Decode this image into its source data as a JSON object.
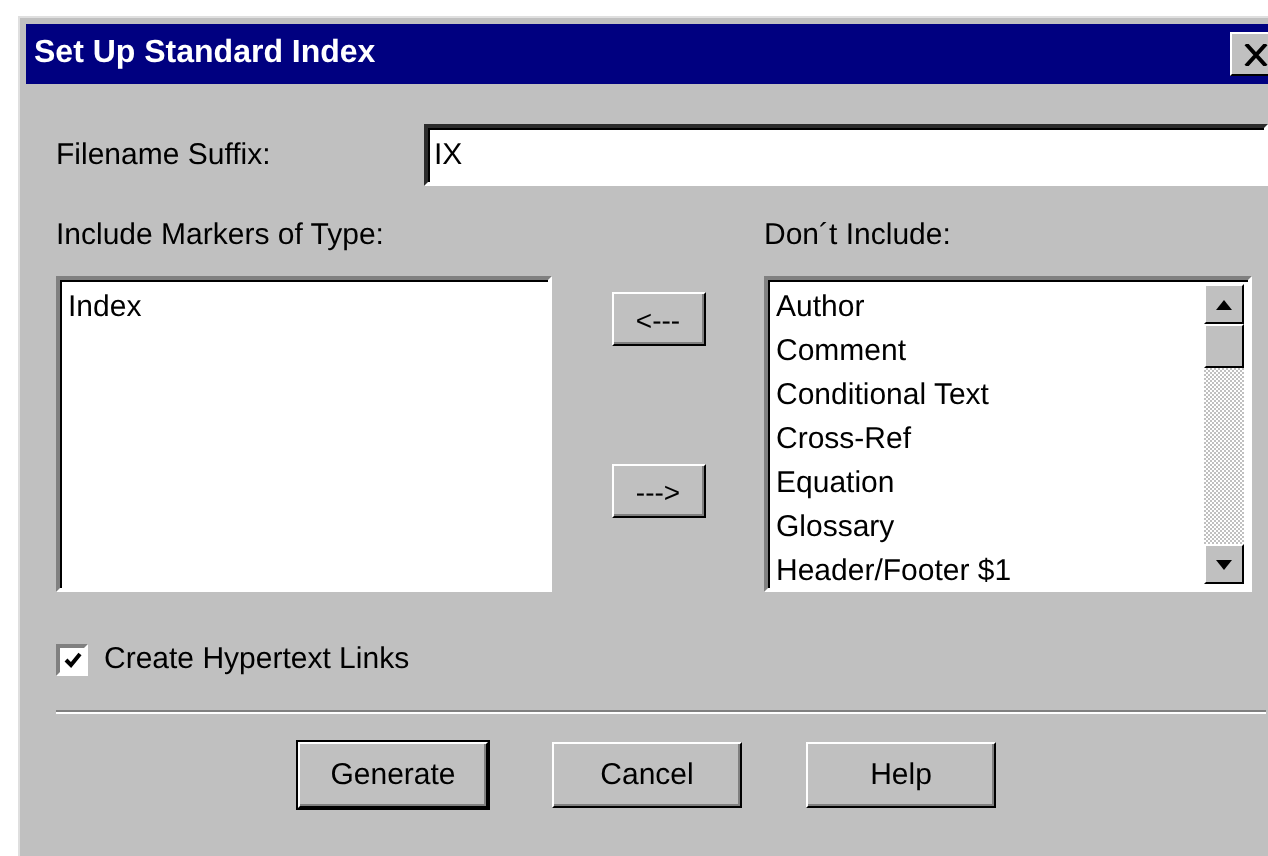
{
  "window": {
    "title": "Set Up Standard Index"
  },
  "filename_suffix": {
    "label": "Filename Suffix:",
    "value": "IX"
  },
  "include_list": {
    "label": "Include Markers of Type:",
    "items": [
      "Index"
    ]
  },
  "move_buttons": [
    "<---",
    "--->"
  ],
  "exclude_list": {
    "label": "Don´t Include:",
    "items": [
      "Author",
      "Comment",
      "Conditional Text",
      "Cross-Ref",
      "Equation",
      "Glossary",
      "Header/Footer $1"
    ]
  },
  "hypertext_links": {
    "label": "Create Hypertext Links",
    "checked": true
  },
  "buttons": [
    {
      "label": "Generate",
      "default": true
    },
    {
      "label": "Cancel",
      "default": false
    },
    {
      "label": "Help",
      "default": false
    }
  ]
}
